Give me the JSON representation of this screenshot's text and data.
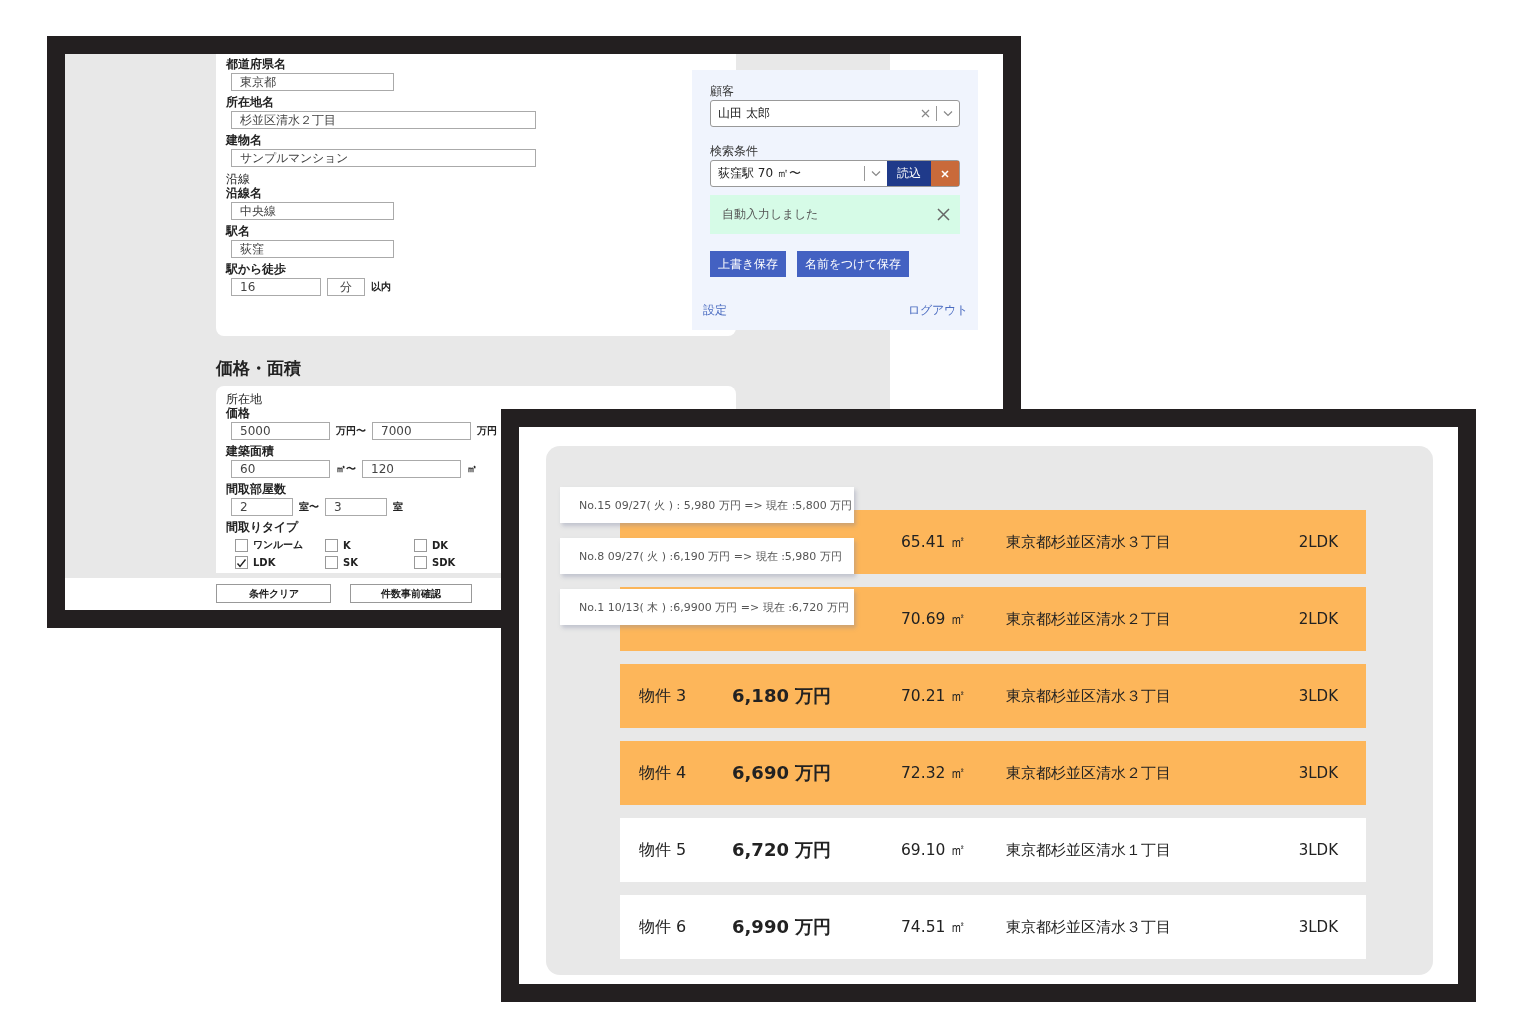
{
  "search_form": {
    "location_fields": [
      {
        "label": "都道府県名",
        "value": "東京都"
      },
      {
        "label": "所在地名",
        "value": "杉並区清水２丁目"
      },
      {
        "label": "建物名",
        "value": "サンプルマンション"
      }
    ],
    "line_section": {
      "title": "沿線",
      "fields": [
        {
          "label": "沿線名",
          "value": "中央線"
        },
        {
          "label": "駅名",
          "value": "荻窪"
        }
      ],
      "walk": {
        "label": "駅から徒歩",
        "value": "16",
        "unit": "分",
        "suffix": "以内"
      }
    },
    "price_area": {
      "heading": "価格・面積",
      "section_title": "所在地",
      "ranges": [
        {
          "label": "価格",
          "from": "5000",
          "from_unit": "万円〜",
          "to": "7000",
          "to_unit": "万円"
        },
        {
          "label": "建築面積",
          "from": "60",
          "from_unit": "㎡〜",
          "to": "120",
          "to_unit": "㎡"
        },
        {
          "label": "間取部屋数",
          "from": "2",
          "from_unit": "室〜",
          "to": "3",
          "to_unit": "室"
        }
      ],
      "layout_types": {
        "label": "間取りタイプ",
        "options": [
          {
            "label": "ワンルーム",
            "checked": false
          },
          {
            "label": "K",
            "checked": false
          },
          {
            "label": "DK",
            "checked": false
          },
          {
            "label": "LDK",
            "checked": true
          },
          {
            "label": "SK",
            "checked": false
          },
          {
            "label": "SDK",
            "checked": false
          }
        ]
      }
    },
    "buttons": [
      "条件クリア",
      "件数事前確認"
    ]
  },
  "customer_panel": {
    "customer_label": "顧客",
    "customer": "山田 太郎",
    "condition_label": "検索条件",
    "condition": "荻窪駅 70 ㎡〜",
    "load_button": "読込",
    "alert": "自動入力しました",
    "save_buttons": [
      "上書き保存",
      "名前をつけて保存"
    ],
    "settings_link": "設定",
    "logout_link": "ログアウト"
  },
  "listings": {
    "rows": [
      {
        "area": "65.41 ㎡",
        "address": "東京都杉並区清水３丁目",
        "layout": "2LDK",
        "highlighted": true
      },
      {
        "area": "70.69 ㎡",
        "address": "東京都杉並区清水２丁目",
        "layout": "2LDK",
        "highlighted": true
      },
      {
        "name": "物件 3",
        "price": "6,180 万円",
        "area": "70.21 ㎡",
        "address": "東京都杉並区清水３丁目",
        "layout": "3LDK",
        "highlighted": true
      },
      {
        "name": "物件 4",
        "price": "6,690 万円",
        "area": "72.32 ㎡",
        "address": "東京都杉並区清水２丁目",
        "layout": "3LDK",
        "highlighted": true
      },
      {
        "name": "物件 5",
        "price": "6,720 万円",
        "area": "69.10 ㎡",
        "address": "東京都杉並区清水１丁目",
        "layout": "3LDK",
        "highlighted": false
      },
      {
        "name": "物件 6",
        "price": "6,990 万円",
        "area": "74.51 ㎡",
        "address": "東京都杉並区清水３丁目",
        "layout": "3LDK",
        "highlighted": false
      }
    ],
    "notifications": [
      "No.15 09/27( 火 ) : 5,980 万円 => 現在 :5,800 万円",
      "No.8 09/27( 火 ) :6,190 万円 => 現在 :5,980 万円",
      "No.1 10/13( 木 ) :6,9900 万円 => 現在 :6,720 万円"
    ]
  }
}
